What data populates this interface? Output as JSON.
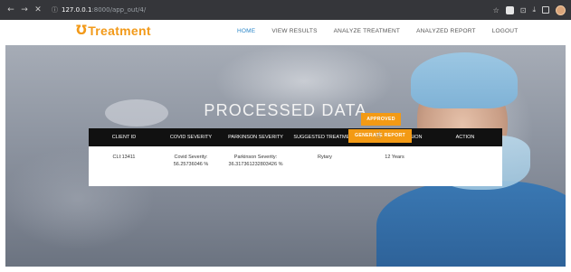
{
  "browser": {
    "back": "←",
    "forward": "→",
    "close": "✕",
    "url_host": "127.0.0.1",
    "url_path": ":8000/app_out/4/"
  },
  "site": {
    "logo_text": "Treatment",
    "nav": [
      "HOME",
      "VIEW RESULTS",
      "ANALYZE TREATMENT",
      "ANALYZED REPORT",
      "LOGOUT"
    ],
    "active_nav": "HOME"
  },
  "hero": {
    "title": "PROCESSED DATA"
  },
  "table": {
    "headers": [
      "CLIENT ID",
      "COVID SEVERITY",
      "PARKINSON SEVERITY",
      "SUGGESTED TREATMENT",
      "LIFE SPAN EXPANSION",
      "ACTION"
    ],
    "row": {
      "client_id": "CLI:13411",
      "covid": "Covid Severity: 56.25736046 %",
      "parkinson": "Parkinson Severity: 36.317361232803426 %",
      "treatment": "Rytary",
      "life_span": "12 Years"
    },
    "actions": {
      "approved": "APPROVED",
      "report": "GENERATE REPORT"
    }
  },
  "colors": {
    "accent": "#f39a14",
    "active_link": "#2a86c8",
    "table_header": "#111111"
  }
}
